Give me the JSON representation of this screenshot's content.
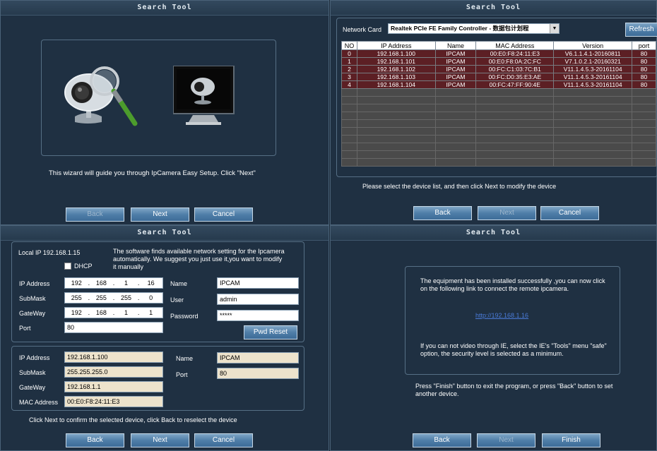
{
  "window_title": "Search Tool",
  "p1": {
    "intro": "This wizard will guide you through IpCamera Easy Setup. Click \"Next\"",
    "back": "Back",
    "next": "Next",
    "cancel": "Cancel"
  },
  "p2": {
    "network_card_label": "Network Card",
    "network_card_value": "Realtek PCIe FE Family Controller - 数据包计划程",
    "refresh": "Refresh",
    "columns": [
      "NO",
      "IP Address",
      "Name",
      "MAC Address",
      "Version",
      "port"
    ],
    "rows": [
      [
        "0",
        "192.168.1.100",
        "IPCAM",
        "00:E0:F8:24:11:E3",
        "V6.1.1.4.1-20160811",
        "80"
      ],
      [
        "1",
        "192.168.1.101",
        "IPCAM",
        "00:E0:F8:0A:2C:FC",
        "V7.1.0.2.1-20160321",
        "80"
      ],
      [
        "2",
        "192.168.1.102",
        "IPCAM",
        "00:FC:C1:03:7C:B1",
        "V11.1.4.5.3-20161104",
        "80"
      ],
      [
        "3",
        "192.168.1.103",
        "IPCAM",
        "00:FC:D0:35:E3:AE",
        "V11.1.4.5.3-20161104",
        "80"
      ],
      [
        "4",
        "192.168.1.104",
        "IPCAM",
        "00:FC:47:FF:90:4E",
        "V11.1.4.5.3-20161104",
        "80"
      ]
    ],
    "instruction": "Please select the device list, and then click Next to modify the device",
    "back": "Back",
    "next": "Next",
    "cancel": "Cancel"
  },
  "p3": {
    "local_ip": "Local IP 192.168.1.15",
    "info": "The software finds available network setting for the Ipcamera automatically. We suggest you just use it,you want to modify it manually",
    "dhcp": "DHCP",
    "ip_label": "IP Address",
    "submask_label": "SubMask",
    "gateway_label": "GateWay",
    "port_label": "Port",
    "mac_label": "MAC Address",
    "ip_octets": [
      "192",
      "168",
      "1",
      "16"
    ],
    "mask_octets": [
      "255",
      "255",
      "255",
      "0"
    ],
    "gw_octets": [
      "192",
      "168",
      "1",
      "1"
    ],
    "port_value": "80",
    "name_label": "Name",
    "user_label": "User",
    "password_label": "Password",
    "name_value": "IPCAM",
    "user_value": "admin",
    "password_value": "*****",
    "pwd_reset": "Pwd Reset",
    "cur_ip": "192.168.1.100",
    "cur_mask": "255.255.255.0",
    "cur_gw": "192.168.1.1",
    "cur_mac": "00:E0:F8:24:11:E3",
    "cur_name": "IPCAM",
    "cur_port": "80",
    "confirm": "Click Next to confirm the selected device, click Back to reselect the device",
    "back": "Back",
    "next": "Next",
    "cancel": "Cancel"
  },
  "p4": {
    "success": "The equipment has been installed successfully ,you can now click on the following link to connect the remote ipcamera.",
    "link": "http://192.168.1.16",
    "ie_note": "If you can not video through IE, select the IE's \"Tools\" menu  \"safe\" option, the security level is selected as a minimum.",
    "finish_note": "Press \"Finish\" button to exit the program, or press \"Back\" button to set another device.",
    "back": "Back",
    "next": "Next",
    "finish": "Finish"
  },
  "colors": {
    "background": "#1f3042",
    "button": "#4f7ea8",
    "table_row": "#5c1f24",
    "link": "#4a7bd8"
  }
}
